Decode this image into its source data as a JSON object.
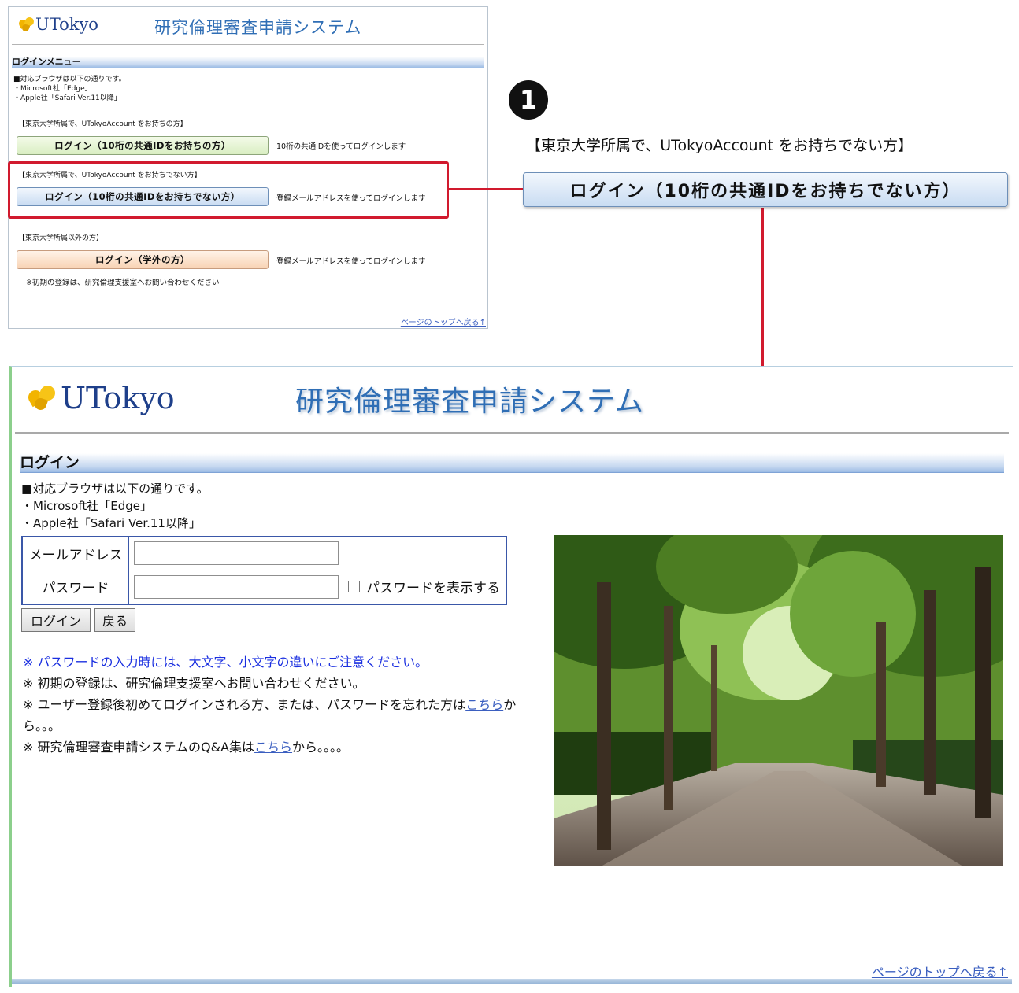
{
  "menu_page": {
    "logo_text": "UTokyo",
    "system_title": "研究倫理審査申請システム",
    "section_title": "ログインメニュー",
    "browser_notice": [
      "■対応ブラウザは以下の通りです。",
      "・Microsoft社「Edge」",
      "・Apple社「Safari Ver.11以降」"
    ],
    "group1_heading": "【東京大学所属で、UTokyoAccount をお持ちの方】",
    "group1_button": "ログイン（10桁の共通IDをお持ちの方）",
    "group1_desc": "10桁の共通IDを使ってログインします",
    "group2_heading": "【東京大学所属で、UTokyoAccount をお持ちでない方】",
    "group2_button": "ログイン（10桁の共通IDをお持ちでない方）",
    "group2_desc": "登録メールアドレスを使ってログインします",
    "group3_heading": "【東京大学所属以外の方】",
    "group3_button": "ログイン（学外の方）",
    "group3_desc": "登録メールアドレスを使ってログインします",
    "initial_note": "※初期の登録は、研究倫理支援室へお問い合わせください",
    "page_top_link": "ページのトップへ戻る↑"
  },
  "callout": {
    "step_number": "1",
    "heading": "【東京大学所属で、UTokyoAccount をお持ちでない方】",
    "button_label": "ログイン（10桁の共通IDをお持ちでない方）"
  },
  "login_page": {
    "logo_text": "UTokyo",
    "system_title": "研究倫理審査申請システム",
    "section_title": "ログイン",
    "browser_notice": [
      "■対応ブラウザは以下の通りです。",
      "・Microsoft社「Edge」",
      "・Apple社「Safari Ver.11以降」"
    ],
    "email_label": "メールアドレス",
    "email_value": "",
    "password_label": "パスワード",
    "password_value": "",
    "show_password_label": "パスワードを表示する",
    "login_button": "ログイン",
    "back_button": "戻る",
    "notice_case": "※ パスワードの入力時には、大文字、小文字の違いにご注意ください。",
    "notice_initial": "※ 初期の登録は、研究倫理支援室へお問い合わせください。",
    "notice_forgot_pre": "※ ユーザー登録後初めてログインされる方、または、パスワードを忘れた方は",
    "notice_forgot_link": "こちら",
    "notice_forgot_post": "から。。。",
    "notice_faq_pre": "※ 研究倫理審査申請システムのQ&A集は",
    "notice_faq_link": "こちら",
    "notice_faq_post": "から。。。。",
    "page_top_link": "ページのトップへ戻る↑"
  },
  "colors": {
    "callout_red": "#d11a2e",
    "title_blue": "#2f6eb5",
    "link_blue": "#3b5fc0",
    "notice_blue": "#1a2fe0"
  }
}
